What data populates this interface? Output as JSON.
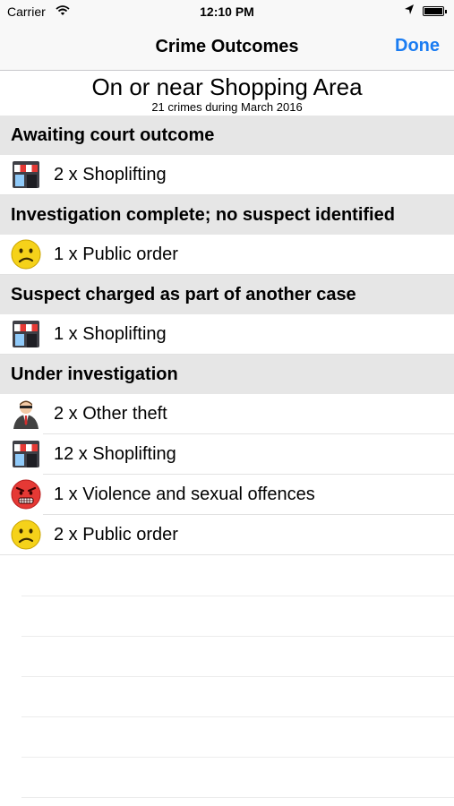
{
  "status_bar": {
    "carrier": "Carrier",
    "time": "12:10 PM"
  },
  "nav": {
    "title": "Crime Outcomes",
    "done_label": "Done"
  },
  "area": {
    "title": "On or near Shopping Area",
    "subtitle": "21 crimes during March 2016"
  },
  "sections": [
    {
      "title": "Awaiting court outcome",
      "rows": [
        {
          "label": "2 x Shoplifting",
          "icon": "shop-icon"
        }
      ]
    },
    {
      "title": "Investigation complete; no suspect identified",
      "rows": [
        {
          "label": "1 x Public order",
          "icon": "worried-face-icon"
        }
      ]
    },
    {
      "title": "Suspect charged as part of another case",
      "rows": [
        {
          "label": "1 x Shoplifting",
          "icon": "shop-icon"
        }
      ]
    },
    {
      "title": "Under investigation",
      "rows": [
        {
          "label": "2 x Other theft",
          "icon": "thief-icon"
        },
        {
          "label": "12 x Shoplifting",
          "icon": "shop-icon"
        },
        {
          "label": "1 x Violence and sexual offences",
          "icon": "angry-face-icon"
        },
        {
          "label": "2 x Public order",
          "icon": "worried-face-icon"
        }
      ]
    }
  ],
  "colors": {
    "accent": "#1a7cf2",
    "section_background": "#e6e6e6"
  }
}
